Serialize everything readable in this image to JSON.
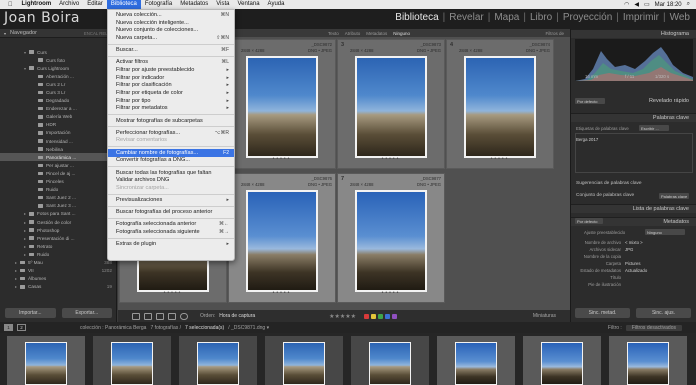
{
  "menubar": {
    "items": [
      "Lightroom",
      "Archivo",
      "Editar",
      "Biblioteca",
      "Fotografía",
      "Metadatos",
      "Vista",
      "Ventana",
      "Ayuda"
    ],
    "active": "Biblioteca",
    "clock": "Mar 18:20"
  },
  "identity": "Joan Boira",
  "modules": [
    {
      "label": "Biblioteca",
      "active": true
    },
    {
      "label": "Revelar",
      "active": false
    },
    {
      "label": "Mapa",
      "active": false
    },
    {
      "label": "Libro",
      "active": false
    },
    {
      "label": "Proyección",
      "active": false
    },
    {
      "label": "Imprimir",
      "active": false
    },
    {
      "label": "Web",
      "active": false
    }
  ],
  "navigator": {
    "title": "Navegador",
    "opts": [
      "ENCAL",
      "RELL"
    ]
  },
  "folders": [
    {
      "label": "Curs",
      "count": "",
      "depth": 2,
      "tri": "▾"
    },
    {
      "label": "Curs foto",
      "count": "",
      "depth": 3,
      "tri": ""
    },
    {
      "label": "Curs Lightroom",
      "count": "",
      "depth": 2,
      "tri": "▾"
    },
    {
      "label": "Aberración ...",
      "count": "",
      "depth": 3,
      "tri": ""
    },
    {
      "label": "Curs 2 Lr",
      "count": "",
      "depth": 3,
      "tri": ""
    },
    {
      "label": "Curs 3 Lr",
      "count": "",
      "depth": 3,
      "tri": ""
    },
    {
      "label": "Degradado",
      "count": "",
      "depth": 3,
      "tri": ""
    },
    {
      "label": "Enderezar a ...",
      "count": "",
      "depth": 3,
      "tri": ""
    },
    {
      "label": "Galería Web",
      "count": "",
      "depth": 3,
      "tri": ""
    },
    {
      "label": "HDR",
      "count": "",
      "depth": 3,
      "tri": ""
    },
    {
      "label": "Importación",
      "count": "",
      "depth": 3,
      "tri": ""
    },
    {
      "label": "Intensidad ...",
      "count": "",
      "depth": 3,
      "tri": ""
    },
    {
      "label": "Nebilina",
      "count": "",
      "depth": 3,
      "tri": ""
    },
    {
      "label": "Panorámica ...",
      "count": "",
      "depth": 3,
      "tri": "",
      "sel": true
    },
    {
      "label": "Per ajustar ...",
      "count": "",
      "depth": 3,
      "tri": ""
    },
    {
      "label": "Pincel de aj ...",
      "count": "",
      "depth": 3,
      "tri": ""
    },
    {
      "label": "Pinceles",
      "count": "",
      "depth": 3,
      "tri": ""
    },
    {
      "label": "Ruido",
      "count": "",
      "depth": 3,
      "tri": ""
    },
    {
      "label": "Sant Juez 2 ...",
      "count": "",
      "depth": 3,
      "tri": ""
    },
    {
      "label": "Sant Juez 3 ...",
      "count": "",
      "depth": 3,
      "tri": ""
    },
    {
      "label": "Fotos para Sant ...",
      "count": "",
      "depth": 2,
      "tri": "▸"
    },
    {
      "label": "Gestión de color",
      "count": "",
      "depth": 2,
      "tri": "▸"
    },
    {
      "label": "Photoshop",
      "count": "",
      "depth": 2,
      "tri": "▸"
    },
    {
      "label": "Presentación di ...",
      "count": "",
      "depth": 2,
      "tri": "▸"
    },
    {
      "label": "Retrato",
      "count": "",
      "depth": 2,
      "tri": "▸"
    },
    {
      "label": "Ruido",
      "count": "",
      "depth": 2,
      "tri": "▸"
    },
    {
      "label": "5º Mau",
      "count": "388",
      "depth": 1,
      "tri": "▸"
    },
    {
      "label": "VII",
      "count": "1202",
      "depth": 1,
      "tri": "▸"
    },
    {
      "label": "Álbumes",
      "count": "",
      "depth": 1,
      "tri": "▸"
    },
    {
      "label": "Casas",
      "count": "19",
      "depth": 1,
      "tri": "▸"
    }
  ],
  "left_buttons": {
    "import": "Importar...",
    "export": "Exportar..."
  },
  "filterbar": {
    "items": [
      "Texto",
      "Atributo",
      "Metadatos",
      "Ninguno"
    ],
    "active": "Ninguno",
    "right": "Filtros de"
  },
  "grid": [
    {
      "idx": "2",
      "name": "_DSC9872",
      "dim": "2848 × 4288",
      "fmt": "DNG • JPEG",
      "sel": false,
      "rock": false
    },
    {
      "idx": "3",
      "name": "_DSC9873",
      "dim": "2848 × 4288",
      "fmt": "DNG • JPEG",
      "sel": false,
      "rock": false
    },
    {
      "idx": "4",
      "name": "_DSC9874",
      "dim": "2848 × 4288",
      "fmt": "DNG • JPEG",
      "sel": false,
      "rock": false
    },
    {
      "idx": "5",
      "name": "",
      "dim": "",
      "fmt": "",
      "sel": false,
      "rock": true
    },
    {
      "idx": "6",
      "name": "_DSC9876",
      "dim": "2848 × 4288",
      "fmt": "DNG • JPEG",
      "sel": true,
      "rock": true
    },
    {
      "idx": "7",
      "name": "_DSC9877",
      "dim": "2848 × 4288",
      "fmt": "DNG • JPEG",
      "sel": true,
      "rock": true
    }
  ],
  "grid_toolbar": {
    "sort_label": "Orden:",
    "sort_value": "Hora de captura",
    "thumbs_label": "Miniaturas"
  },
  "colors": {
    "labels": [
      "#d83a3a",
      "#e5c63a",
      "#3fa54a",
      "#3b6fd4",
      "#9050c0"
    ],
    "accent": "#3b74e4"
  },
  "menu": [
    {
      "label": "Nueva colección...",
      "sc": "⌘N"
    },
    {
      "label": "Nueva colección inteligente...",
      "sc": ""
    },
    {
      "label": "Nuevo conjunto de colecciones...",
      "sc": ""
    },
    {
      "label": "Nueva carpeta...",
      "sc": "⇧⌘N"
    },
    {
      "sep": true
    },
    {
      "label": "Buscar...",
      "sc": "⌘F"
    },
    {
      "sep": true
    },
    {
      "label": "Activar filtros",
      "sc": "⌘L"
    },
    {
      "label": "Filtrar por ajuste preestablecido",
      "sc": "▸"
    },
    {
      "label": "Filtrar por indicador",
      "sc": "▸"
    },
    {
      "label": "Filtrar por clasificación",
      "sc": "▸"
    },
    {
      "label": "Filtrar por etiqueta de color",
      "sc": "▸"
    },
    {
      "label": "Filtrar por tipo",
      "sc": "▸"
    },
    {
      "label": "Filtrar por metadatos",
      "sc": "▸"
    },
    {
      "sep": true
    },
    {
      "label": "Mostrar fotografías de subcarpetas",
      "sc": ""
    },
    {
      "sep": true
    },
    {
      "label": "Perfeccionar fotografías...",
      "sc": "⌥⌘R"
    },
    {
      "label": "Revisar comentarios",
      "sc": "",
      "dis": true
    },
    {
      "sep": true
    },
    {
      "label": "Cambiar nombre de fotografías...",
      "sc": "F2",
      "hl": true
    },
    {
      "label": "Convertir fotografías a DNG...",
      "sc": ""
    },
    {
      "sep": true
    },
    {
      "label": "Buscar todas las fotografías que faltan",
      "sc": ""
    },
    {
      "label": "Validar archivos DNG",
      "sc": ""
    },
    {
      "label": "Sincronizar carpeta...",
      "sc": "",
      "dis": true
    },
    {
      "sep": true
    },
    {
      "label": "Previsualizaciones",
      "sc": "▸"
    },
    {
      "sep": true
    },
    {
      "label": "Buscar fotografías del proceso anterior",
      "sc": ""
    },
    {
      "sep": true
    },
    {
      "label": "Fotografía seleccionada anterior",
      "sc": "⌘←"
    },
    {
      "label": "Fotografía seleccionada siguiente",
      "sc": "⌘→"
    },
    {
      "sep": true
    },
    {
      "label": "Extras de plugin",
      "sc": "▸"
    }
  ],
  "right": {
    "histogram_title": "Histograma",
    "hist_info": [
      "16 mm",
      "f / 11",
      "1/320 s"
    ],
    "quick_dev_title": "Revelado rápido",
    "quick_dev_preset": "Por defecto",
    "keywords_title": "Palabras clave",
    "keyword_label": "Etiquetas de palabras clave",
    "keyword_select": "Escribir ...",
    "keyword_value": "Berga 2017",
    "suggest_title": "Sugerencias de palabras clave",
    "set_title": "Conjunto de palabras clave",
    "set_value": "Palabras clave",
    "list_title": "Lista de palabras clave",
    "metadata_title": "Metadatos",
    "metadata_preset": "Por defecto",
    "metadata_preset_label": "Ajuste preestablecido",
    "metadata_preset_value": "Ninguno",
    "meta_rows": [
      {
        "k": "Nombre de archivo",
        "v": "< mixto >"
      },
      {
        "k": "Archivos sidecar",
        "v": "JPG"
      },
      {
        "k": "Nombre de la copia",
        "v": ""
      },
      {
        "k": "Carpeta",
        "v": "Pictures"
      },
      {
        "k": "Estado de metadatos",
        "v": "Actualizado"
      },
      {
        "k": "Título",
        "v": ""
      },
      {
        "k": "Pie de ilustración",
        "v": ""
      }
    ],
    "sync_meta": "Sinc. metad.",
    "sync_settings": "Sinc. ajus."
  },
  "filmstrip_bar": {
    "pages": [
      "1",
      "2"
    ],
    "path": "colección : Panorámica Berga",
    "count": "7 fotografías /",
    "selected": "7 seleccionada(s)",
    "file": "/ _DSC9871.dng ▾",
    "filter_label": "Filtro :",
    "filter_value": "Filtros desactivados"
  }
}
